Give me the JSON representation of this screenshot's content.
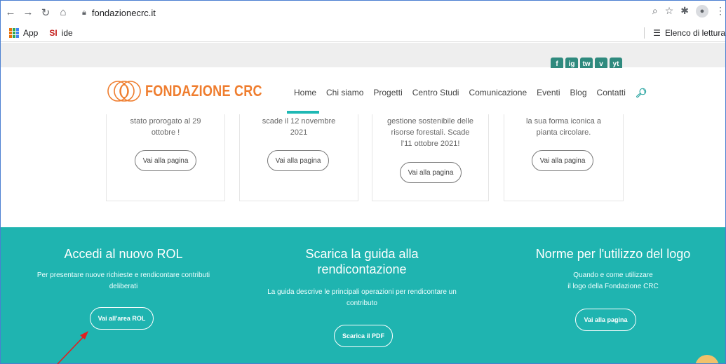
{
  "browser": {
    "url": "fondazionecrc.it",
    "bookmarks": [
      {
        "label": "App"
      },
      {
        "label": "ide",
        "prefix": "SI"
      }
    ],
    "reading_list": "Elenco di lettura"
  },
  "site": {
    "logo_text": "FONDAZIONE CRC",
    "social": [
      "f",
      "ig",
      "tw",
      "v",
      "yt"
    ],
    "menu": [
      "Home",
      "Chi siamo",
      "Progetti",
      "Centro Studi",
      "Comunicazione",
      "Eventi",
      "Blog",
      "Contatti"
    ],
    "accent": "#1fb4b0",
    "brand_orange": "#ef7d2e"
  },
  "cards": [
    {
      "lines": [
        "stato prorogato al 29",
        "ottobre !"
      ],
      "button": "Vai alla pagina"
    },
    {
      "lines": [
        "scade il 12 novembre",
        "2021"
      ],
      "button": "Vai alla pagina"
    },
    {
      "lines": [
        "gestione sostenibile delle",
        "risorse forestali. Scade",
        "l'11 ottobre 2021!"
      ],
      "button": "Vai alla pagina"
    },
    {
      "lines": [
        "la sua forma iconica a",
        "pianta circolare."
      ],
      "button": "Vai alla pagina"
    }
  ],
  "teal_section": {
    "rol": {
      "title": "Accedi al nuovo ROL",
      "desc": [
        "Per presentare nuove richieste e rendicontare contributi",
        "deliberati"
      ],
      "button": "Vai all'area ROL"
    },
    "guida": {
      "title": [
        "Scarica la guida alla",
        "rendicontazione"
      ],
      "desc": [
        "La guida descrive le principali operazioni per rendicontare un",
        "contributo"
      ],
      "button": "Scarica il PDF"
    },
    "logo": {
      "title": "Norme per l'utilizzo del logo",
      "desc": [
        "Quando e come utilizzare",
        "il logo della Fondazione CRC"
      ],
      "button": "Vai alla pagina"
    }
  }
}
